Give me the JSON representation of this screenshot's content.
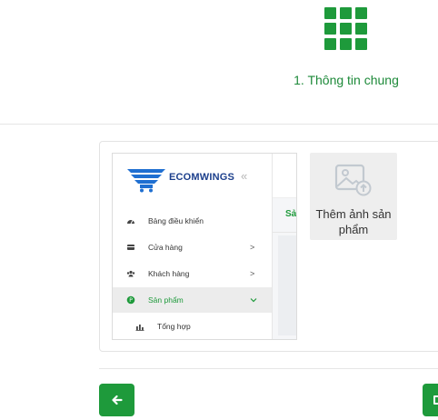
{
  "step": {
    "icon": "grid-icon",
    "accent_color": "#1e9a3b",
    "title": "1. Thông tin chung"
  },
  "preview": {
    "brand": "ECOMWINGS",
    "collapse_icon": "double-chevron-left-icon",
    "main_tab_label": "Sả",
    "menu": [
      {
        "icon": "dashboard-icon",
        "label": "Bảng điều khiển",
        "chevron": ""
      },
      {
        "icon": "store-icon",
        "label": "Cửa hàng",
        "chevron": ">"
      },
      {
        "icon": "users-icon",
        "label": "Khách hàng",
        "chevron": ">"
      },
      {
        "icon": "product-icon",
        "label": "Sản phẩm",
        "chevron": "v",
        "active": true
      }
    ],
    "submenu": {
      "icon": "chart-icon",
      "label": "Tổng hợp"
    }
  },
  "add_photo": {
    "icon": "image-upload-icon",
    "label": "Thêm ảnh sản phẩm"
  },
  "footer": {
    "back_icon": "arrow-left-icon",
    "next_icon": "save-icon"
  }
}
